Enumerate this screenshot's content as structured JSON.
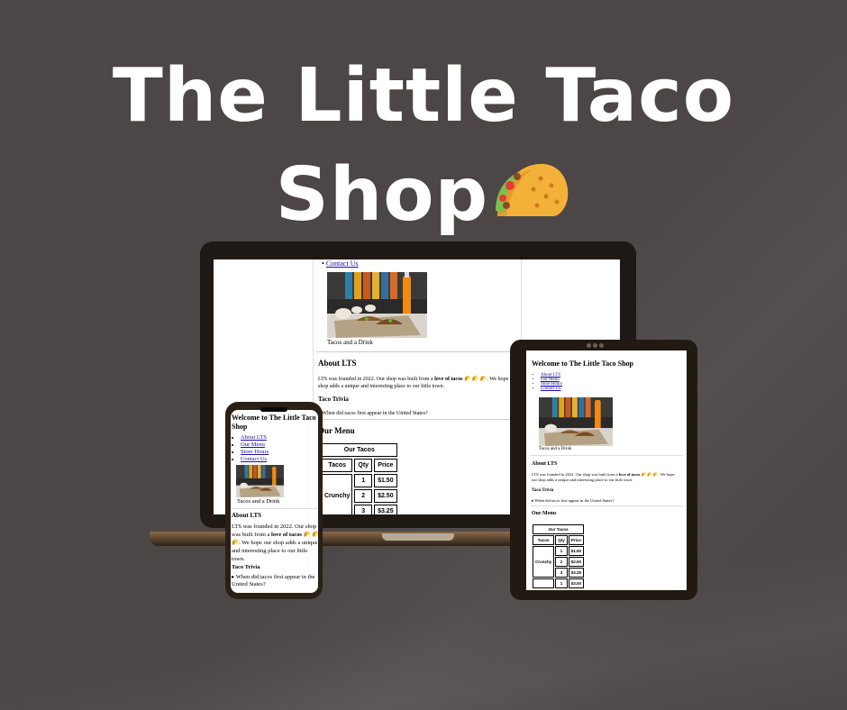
{
  "hero": {
    "title_line1": "The Little Taco",
    "title_line2": "Shop",
    "emoji_icon": "taco-emoji"
  },
  "site": {
    "welcome_heading": "Welcome to The Little Taco Shop",
    "nav": [
      "About LTS",
      "Our Menu",
      "Store Hours",
      "Contact Us"
    ],
    "photo_caption": "Tacos and a Drink",
    "about_heading_prefix": "About ",
    "about_abbr": "LTS",
    "about_text_start": " was founded in 2022. Our shop was built from a ",
    "about_bold": "love of tacos",
    "about_emojis": "🌮 🌮 🌮",
    "about_text_end": ". We hope our shop adds a unique and interesting place to our little town.",
    "trivia_heading": "Taco Trivia",
    "trivia_question": "When did tacos first appear in the United States?",
    "menu_heading": "Our Menu",
    "table": {
      "caption": "Our Tacos",
      "headers": [
        "Tacos",
        "Qty",
        "Price"
      ],
      "rows": [
        {
          "taco": "Crunchy",
          "qty": "1",
          "price": "$1.50"
        },
        {
          "taco": "",
          "qty": "2",
          "price": "$2.50"
        },
        {
          "taco": "",
          "qty": "3",
          "price": "$3.25"
        },
        {
          "taco": "",
          "qty": "1",
          "price": "$3.00"
        }
      ]
    }
  },
  "colors": {
    "background": "#4c4646",
    "title": "#ffffff",
    "link": "#1a0dab",
    "device_frame": "#1e1914"
  }
}
